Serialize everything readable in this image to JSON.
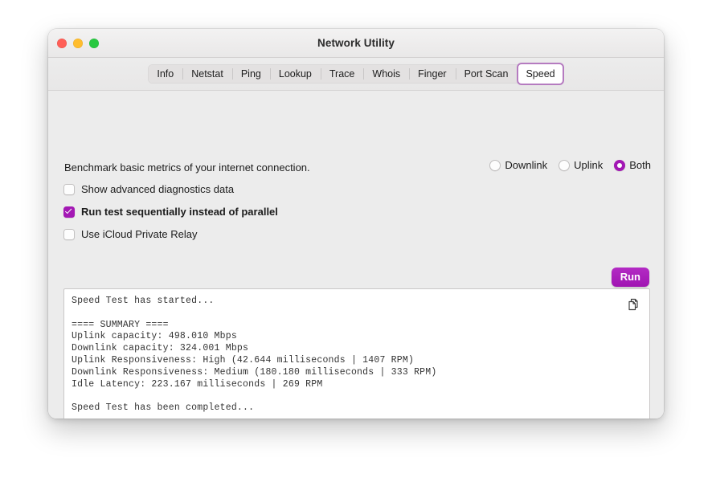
{
  "window": {
    "title": "Network Utility",
    "traffic_lights": [
      {
        "name": "close",
        "color": "#ff5f57"
      },
      {
        "name": "minimize",
        "color": "#ffbd2e"
      },
      {
        "name": "maximize",
        "color": "#28c840"
      }
    ]
  },
  "tabs": [
    {
      "label": "Info",
      "selected": false
    },
    {
      "label": "Netstat",
      "selected": false
    },
    {
      "label": "Ping",
      "selected": false
    },
    {
      "label": "Lookup",
      "selected": false
    },
    {
      "label": "Trace",
      "selected": false
    },
    {
      "label": "Whois",
      "selected": false
    },
    {
      "label": "Finger",
      "selected": false
    },
    {
      "label": "Port Scan",
      "selected": false
    },
    {
      "label": "Speed",
      "selected": true
    }
  ],
  "main": {
    "description": "Benchmark basic metrics of your internet connection.",
    "mode_options": [
      {
        "label": "Downlink",
        "selected": false
      },
      {
        "label": "Uplink",
        "selected": false
      },
      {
        "label": "Both",
        "selected": true
      }
    ],
    "checkboxes": [
      {
        "label": "Show advanced diagnostics data",
        "checked": false
      },
      {
        "label": "Run test sequentially instead of parallel",
        "checked": true
      },
      {
        "label": "Use iCloud Private Relay",
        "checked": false
      }
    ],
    "run_label": "Run",
    "copy_icon": "copy-icon",
    "log": "Speed Test has started...\n\n==== SUMMARY ====\nUplink capacity: 498.010 Mbps\nDownlink capacity: 324.001 Mbps\nUplink Responsiveness: High (42.644 milliseconds | 1407 RPM)\nDownlink Responsiveness: Medium (180.180 milliseconds | 333 RPM)\nIdle Latency: 223.167 milliseconds | 269 RPM\n\nSpeed Test has been completed...",
    "log_values": {
      "uplink_capacity_mbps": 498.01,
      "downlink_capacity_mbps": 324.001,
      "uplink_responsiveness_rating": "High",
      "uplink_responsiveness_ms": 42.644,
      "uplink_responsiveness_rpm": 1407,
      "downlink_responsiveness_rating": "Medium",
      "downlink_responsiveness_ms": 180.18,
      "downlink_responsiveness_rpm": 333,
      "idle_latency_ms": 223.167,
      "idle_latency_rpm": 269
    }
  },
  "colors": {
    "accent": "#a318b4",
    "tab_selected_border": "#b57bc0",
    "window_bg": "#ececec"
  }
}
